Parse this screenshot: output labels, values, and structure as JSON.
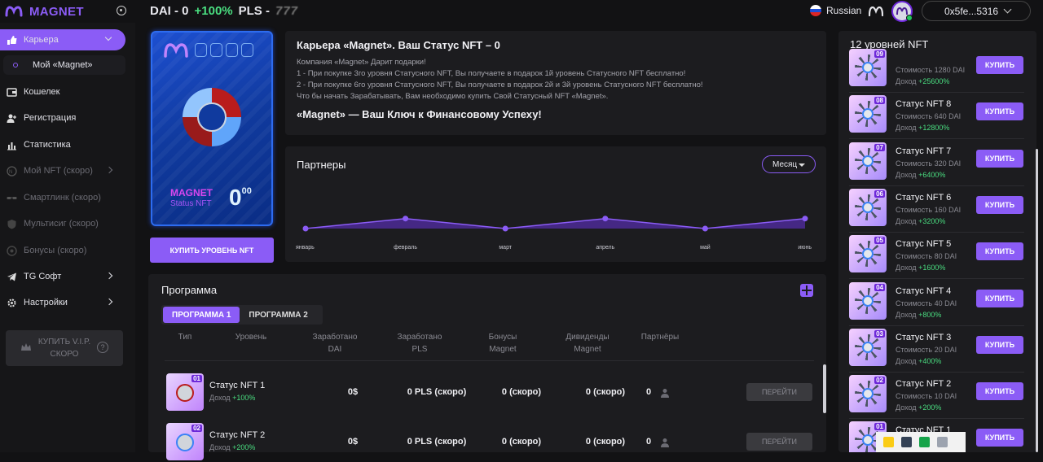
{
  "header": {
    "brand": "MAGNET",
    "dai_price": "DAI - 0",
    "change": "+100%",
    "pls_label": "PLS -",
    "pls_value": "777",
    "language": "Russian",
    "wallet": "0x5fe...5316"
  },
  "sidebar": {
    "items": [
      {
        "label": "Карьера",
        "icon": "thumbs-up-icon"
      },
      {
        "label": "Мой «Magnet»",
        "icon": "dot-icon"
      },
      {
        "label": "Кошелек",
        "icon": "wallet-icon"
      },
      {
        "label": "Регистрация",
        "icon": "user-plus-icon"
      },
      {
        "label": "Статистика",
        "icon": "bar-chart-icon"
      },
      {
        "label": "Мой NFT (скоро)",
        "icon": "nft-icon"
      },
      {
        "label": "Смартлинк (скоро)",
        "icon": "glasses-icon"
      },
      {
        "label": "Мультисиг (скоро)",
        "icon": "shield-icon"
      },
      {
        "label": "Бонусы (скоро)",
        "icon": "coin-icon"
      },
      {
        "label": "TG Софт",
        "icon": "telegram-icon"
      },
      {
        "label": "Настройки",
        "icon": "gear-icon"
      }
    ],
    "vip_line1": "КУПИТЬ V.I.P.",
    "vip_line2": "СКОРО"
  },
  "nft_card": {
    "brand": "MAGNET",
    "subtitle": "Status NFT",
    "value": "0",
    "value_sup": "00",
    "buy_button": "КУПИТЬ УРОВЕНЬ NFT"
  },
  "career": {
    "title": "Карьера «Magnet». Ваш Статус NFT – 0",
    "lines": [
      "Компания «Magnet» Дарит подарки!",
      "1 - При покупке 3го уровня Статусного NFT, Вы получаете в подарок 1й уровень Статусного NFT бесплатно!",
      "2 - При покупке 6го уровня Статусного NFT, Вы получаете в подарок 2й и 3й уровень Статусного NFT бесплатно!",
      "Что бы начать Зарабатывать, Вам необходимо купить Свой Статусный NFT «Magnet»."
    ],
    "slogan": "«Magnet» — Ваш Ключ к Финансовому Успеху!"
  },
  "partners": {
    "title": "Партнеры",
    "period": "Месяц"
  },
  "chart_data": {
    "type": "area",
    "categories": [
      "январь",
      "февраль",
      "март",
      "апрель",
      "май",
      "июнь"
    ],
    "values": [
      0,
      3,
      0,
      3,
      0,
      3
    ],
    "title": "",
    "xlabel": "",
    "ylabel": "",
    "ylim": [
      0,
      10
    ],
    "grid": false,
    "color": "#8b5cf6"
  },
  "program": {
    "title": "Программа",
    "tabs": [
      "ПРОГРАММА 1",
      "ПРОГРАММА 2"
    ],
    "columns": [
      "Тип",
      "Уровень",
      "Заработано DAI",
      "Заработано PLS",
      "Бонусы Magnet",
      "Дивиденды Magnet",
      "Партнёры"
    ],
    "income_label": "Доход",
    "rows": [
      {
        "num": "01",
        "name": "Статус NFT 1",
        "income": "+100%",
        "dai": "0$",
        "pls": "0 PLS (скоро)",
        "bonus": "0 (скоро)",
        "dividends": "0 (скоро)",
        "partners": "0",
        "action": "ПЕРЕЙТИ"
      },
      {
        "num": "02",
        "name": "Статус NFT 2",
        "income": "+200%",
        "dai": "0$",
        "pls": "0 PLS (скоро)",
        "bonus": "0 (скоро)",
        "dividends": "0 (скоро)",
        "partners": "0",
        "action": "ПЕРЕЙТИ"
      }
    ]
  },
  "levels": {
    "title": "12 уровней NFT",
    "cost_label": "Стоимость",
    "income_label": "Доход",
    "buy_label": "КУПИТЬ",
    "items": [
      {
        "num": "09",
        "name": "",
        "cost": "1280 DAI",
        "income": "+25600%"
      },
      {
        "num": "08",
        "name": "Статус NFT 8",
        "cost": "640 DAI",
        "income": "+12800%"
      },
      {
        "num": "07",
        "name": "Статус NFT 7",
        "cost": "320 DAI",
        "income": "+6400%"
      },
      {
        "num": "06",
        "name": "Статус NFT 6",
        "cost": "160 DAI",
        "income": "+3200%"
      },
      {
        "num": "05",
        "name": "Статус NFT 5",
        "cost": "80 DAI",
        "income": "+1600%"
      },
      {
        "num": "04",
        "name": "Статус NFT 4",
        "cost": "40 DAI",
        "income": "+800%"
      },
      {
        "num": "03",
        "name": "Статус NFT 3",
        "cost": "20 DAI",
        "income": "+400%"
      },
      {
        "num": "02",
        "name": "Статус NFT 2",
        "cost": "10 DAI",
        "income": "+200%"
      },
      {
        "num": "01",
        "name": "Статус NFT 1",
        "cost": "",
        "income": ""
      }
    ]
  }
}
